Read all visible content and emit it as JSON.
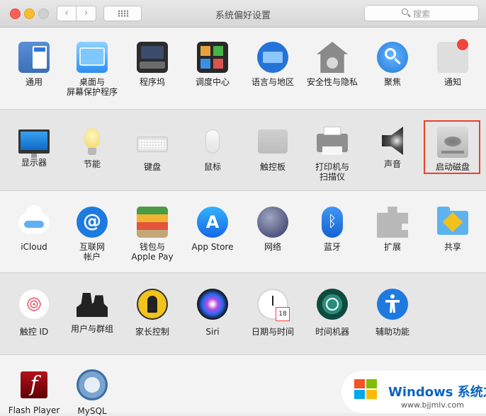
{
  "window": {
    "title": "系统偏好设置"
  },
  "toolbar": {
    "back": "‹",
    "forward": "›",
    "search_placeholder": "搜索"
  },
  "rows": [
    [
      {
        "label": "通用"
      },
      {
        "label": "桌面与\n屏幕保护程序"
      },
      {
        "label": "程序坞"
      },
      {
        "label": "调度中心"
      },
      {
        "label": "语言与地区"
      },
      {
        "label": "安全性与隐私"
      },
      {
        "label": "聚焦"
      },
      {
        "label": "通知"
      }
    ],
    [
      {
        "label": "显示器"
      },
      {
        "label": "节能"
      },
      {
        "label": "键盘"
      },
      {
        "label": "鼠标"
      },
      {
        "label": "触控板"
      },
      {
        "label": "打印机与\n扫描仪"
      },
      {
        "label": "声音"
      },
      {
        "label": "启动磁盘"
      }
    ],
    [
      {
        "label": "iCloud"
      },
      {
        "label": "互联网\n帐户",
        "glyph": "@"
      },
      {
        "label": "钱包与\nApple Pay"
      },
      {
        "label": "App Store",
        "glyph": "A"
      },
      {
        "label": "网络"
      },
      {
        "label": "蓝牙",
        "glyph": "ᛒ"
      },
      {
        "label": "扩展"
      },
      {
        "label": "共享"
      }
    ],
    [
      {
        "label": "触控 ID"
      },
      {
        "label": "用户与群组"
      },
      {
        "label": "家长控制"
      },
      {
        "label": "Siri"
      },
      {
        "label": "日期与时间"
      },
      {
        "label": "时间机器"
      },
      {
        "label": "辅助功能"
      }
    ],
    [
      {
        "label": "Flash Player",
        "glyph": "f"
      },
      {
        "label": "MySQL"
      }
    ]
  ],
  "icons": {
    "row0": [
      "general-icon",
      "desktop-screensaver-icon",
      "dock-icon",
      "mission-control-icon",
      "language-region-icon",
      "security-privacy-icon",
      "spotlight-icon",
      "notifications-icon"
    ],
    "row1": [
      "displays-icon",
      "energy-saver-icon",
      "keyboard-icon",
      "mouse-icon",
      "trackpad-icon",
      "printer-scanner-icon",
      "sound-icon",
      "startup-disk-icon"
    ],
    "row2": [
      "icloud-icon",
      "internet-accounts-icon",
      "wallet-icon",
      "app-store-icon",
      "network-icon",
      "bluetooth-icon",
      "extensions-icon",
      "sharing-icon"
    ],
    "row3": [
      "touch-id-icon",
      "users-groups-icon",
      "parental-controls-icon",
      "siri-icon",
      "date-time-icon",
      "time-machine-icon",
      "accessibility-icon"
    ],
    "row4": [
      "flash-player-icon",
      "mysql-icon"
    ]
  },
  "highlight": {
    "target": "启动磁盘",
    "color": "#e8412a"
  },
  "watermark": {
    "brand": "Windows 系统之家",
    "site": "www.bjjmlv.com"
  }
}
